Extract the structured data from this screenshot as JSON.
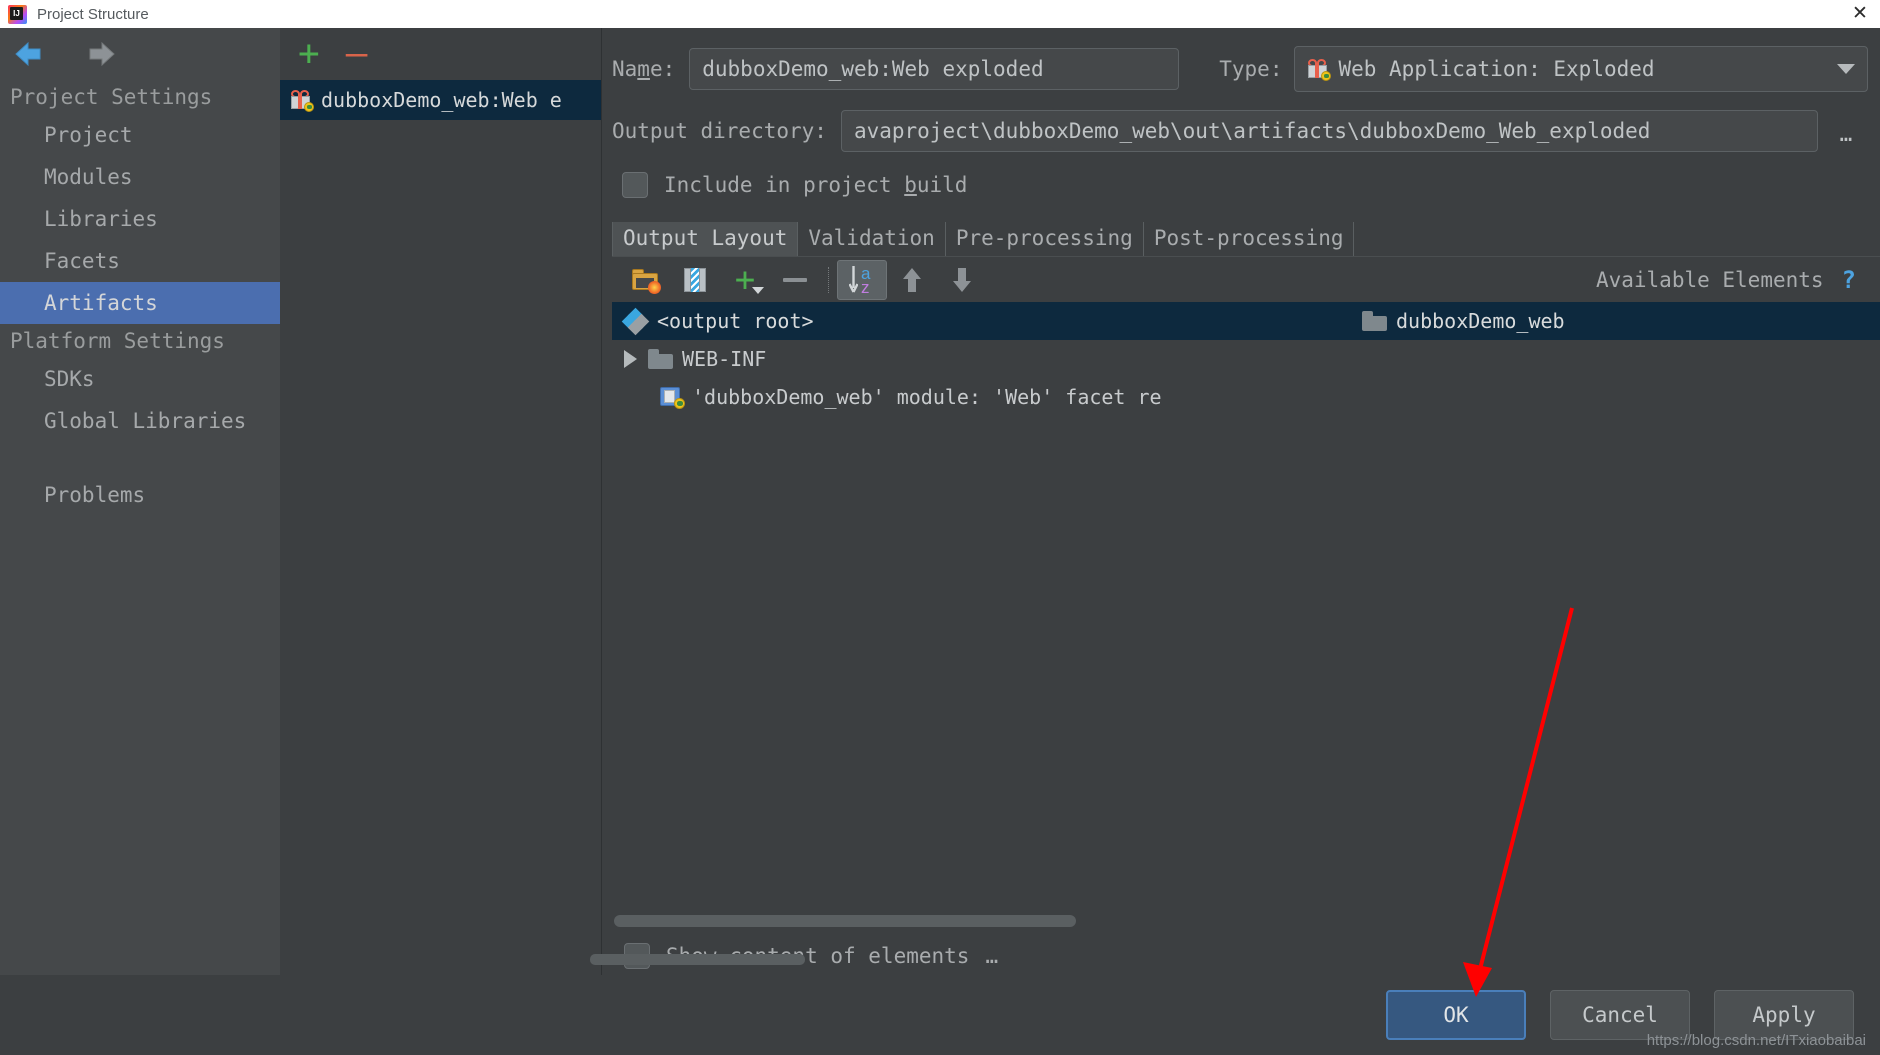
{
  "window": {
    "title": "Project Structure",
    "logo_icon": "intellij-idea-logo",
    "close_icon": "close-icon"
  },
  "sidebar": {
    "back_icon": "back-arrow-icon",
    "forward_icon": "forward-arrow-icon",
    "sections": [
      {
        "label": "Project Settings",
        "items": [
          {
            "label": "Project",
            "selected": false
          },
          {
            "label": "Modules",
            "selected": false
          },
          {
            "label": "Libraries",
            "selected": false
          },
          {
            "label": "Facets",
            "selected": false
          },
          {
            "label": "Artifacts",
            "selected": true
          }
        ]
      },
      {
        "label": "Platform Settings",
        "items": [
          {
            "label": "SDKs",
            "selected": false
          },
          {
            "label": "Global Libraries",
            "selected": false
          }
        ]
      }
    ],
    "extra_items": [
      {
        "label": "Problems",
        "selected": false
      }
    ],
    "help_label": "?",
    "help_icon": "help-icon"
  },
  "artifact_list": {
    "add_label": "+",
    "remove_label": "—",
    "add_icon": "plus-icon",
    "remove_icon": "minus-icon",
    "items": [
      {
        "label": "dubboxDemo_web:Web e",
        "icon": "web-artifact-icon",
        "selected": true
      }
    ]
  },
  "detail": {
    "name_label_pre": "Na",
    "name_label_mnemonic": "m",
    "name_label_post": "e:",
    "name_value": "dubboxDemo_web:Web exploded",
    "type_label": "Type:",
    "type_value": "Web Application: Exploded",
    "type_icon": "web-artifact-icon",
    "type_caret_icon": "chevron-down-icon",
    "outdir_label": "Output directory:",
    "outdir_value": "avaproject\\dubboxDemo_web\\out\\artifacts\\dubboxDemo_Web_exploded",
    "browse_label": "…",
    "include_build_pre": "Include in project ",
    "include_build_mnemonic": "b",
    "include_build_post": "uild",
    "include_build_checked": false,
    "tabs": [
      {
        "label": "Output Layout",
        "active": true
      },
      {
        "label": "Validation",
        "active": false
      },
      {
        "label": "Pre-processing",
        "active": false
      },
      {
        "label": "Post-processing",
        "active": false
      }
    ],
    "toolbar": [
      {
        "name": "create-directory-button",
        "icon": "new-folder-icon",
        "pressed": false
      },
      {
        "name": "create-archive-button",
        "icon": "archive-zip-icon",
        "pressed": false
      },
      {
        "name": "add-copy-button",
        "icon": "plus-dropdown-icon",
        "pressed": false
      },
      {
        "name": "remove-button",
        "icon": "minus-icon",
        "pressed": false
      },
      {
        "name": "sort-button",
        "icon": "sort-az-icon",
        "pressed": true
      },
      {
        "name": "move-up-button",
        "icon": "arrow-up-icon",
        "pressed": false
      },
      {
        "name": "move-down-button",
        "icon": "arrow-down-icon",
        "pressed": false
      }
    ],
    "available_elements_label": "Available Elements",
    "help_mark": "?",
    "output_tree": [
      {
        "label": "<output root>",
        "icon": "artifact-root-icon",
        "indent": 0,
        "selected": true,
        "expander": false
      },
      {
        "label": "WEB-INF",
        "icon": "folder-icon",
        "indent": 0,
        "selected": false,
        "expander": true
      },
      {
        "label": "'dubboxDemo_web' module: 'Web' facet re",
        "icon": "facet-resources-icon",
        "indent": 1,
        "selected": false,
        "expander": false
      }
    ],
    "available_tree": [
      {
        "label": "dubboxDemo_web",
        "icon": "folder-icon",
        "selected": true
      }
    ],
    "show_content_label": "Show content of elements",
    "show_content_more": "…",
    "show_content_checked": false
  },
  "buttons": [
    {
      "label": "OK",
      "default": true
    },
    {
      "label": "Cancel",
      "default": false
    },
    {
      "label": "Apply",
      "default": false
    }
  ],
  "annotation": {
    "arrow_color": "#ff0000"
  },
  "watermark": "https://blog.csdn.net/ITxiaobaibai",
  "colors": {
    "accent_selection": "#4b6eaf",
    "tree_selection": "#0d293e",
    "default_button": "#365880",
    "panel_bg": "#3c3f41",
    "sidebar_bg": "#45484a"
  }
}
